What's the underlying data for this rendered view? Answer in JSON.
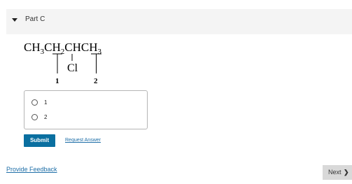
{
  "part": {
    "title": "Part C"
  },
  "structure": {
    "carbon_groups": [
      "CH",
      "3",
      "CH",
      "2",
      "CHCH",
      "3"
    ],
    "substituent": "Cl",
    "label_1": "1",
    "label_2": "2"
  },
  "choices": [
    {
      "label": "1",
      "selected": false
    },
    {
      "label": "2",
      "selected": false
    }
  ],
  "actions": {
    "submit_label": "Submit",
    "request_answer_label": "Request Answer"
  },
  "footer": {
    "feedback_label": "Provide Feedback",
    "next_label": "Next",
    "next_chevron": "❯"
  },
  "colors": {
    "accent": "#0a6fa0",
    "link": "#1f6fa8",
    "header_bg": "#f4f4f4"
  }
}
